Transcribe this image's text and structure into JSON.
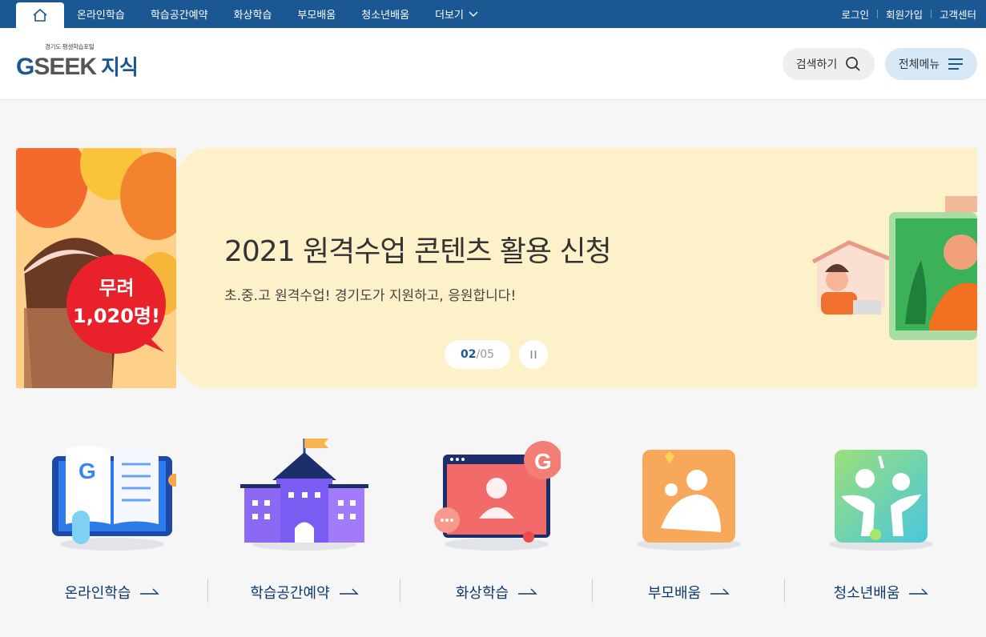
{
  "topbar": {
    "home_icon": "home-icon",
    "nav": [
      "온라인학습",
      "학습공간예약",
      "화상학습",
      "부모배움",
      "청소년배움"
    ],
    "more_label": "더보기",
    "util": [
      "로그인",
      "회원가입",
      "고객센터"
    ]
  },
  "header": {
    "logo_sub": "경기도 평생학습포털",
    "logo_g": "G",
    "logo_seek": "SEEK",
    "logo_jisik": "지식",
    "search_label": "검색하기",
    "menu_label": "전체메뉴"
  },
  "banner": {
    "promo_text_1": "무려",
    "promo_text_2": "1,020명!",
    "title": "2021 원격수업 콘텐츠 활용 신청",
    "desc": "초.중.고 원격수업! 경기도가 지원하고, 응원합니다!",
    "current": "02",
    "separator": "/",
    "total": "05"
  },
  "quick": [
    {
      "label": "온라인학습",
      "icon": "online-learning-icon"
    },
    {
      "label": "학습공간예약",
      "icon": "school-building-icon"
    },
    {
      "label": "화상학습",
      "icon": "video-learning-icon"
    },
    {
      "label": "부모배움",
      "icon": "parent-learning-icon"
    },
    {
      "label": "청소년배움",
      "icon": "youth-learning-icon"
    }
  ],
  "colors": {
    "brand": "#1b5793",
    "banner_bg": "#fcf1c8",
    "menu_btn_bg": "#d7e8f6"
  }
}
